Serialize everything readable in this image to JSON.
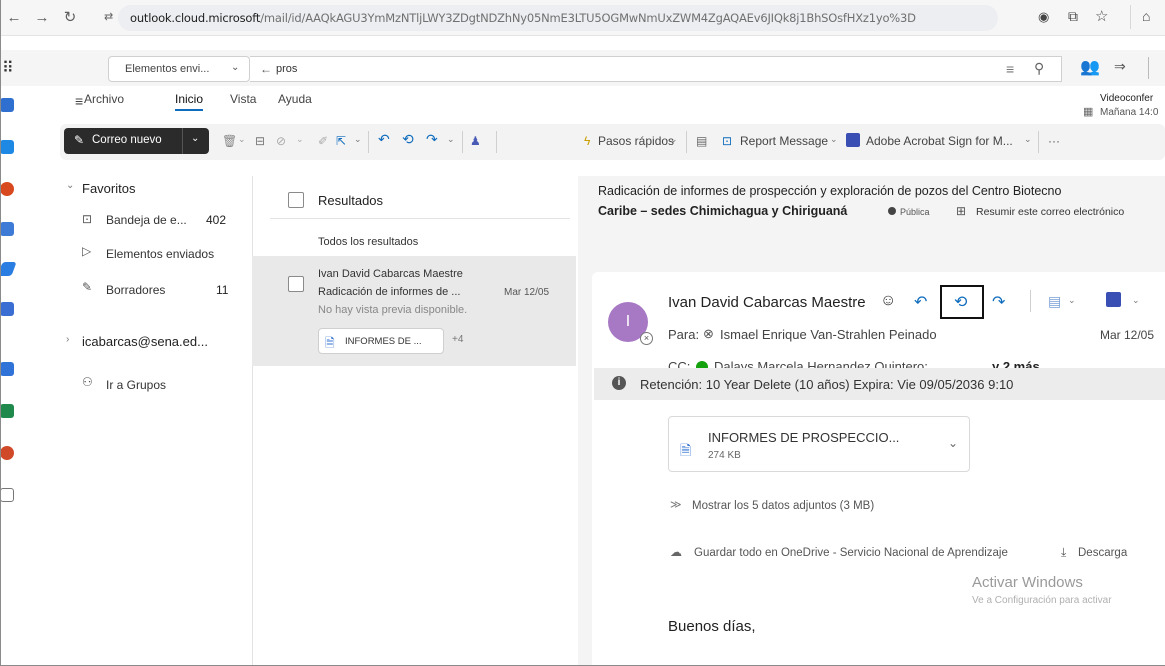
{
  "browser": {
    "url_host": "outlook.cloud.microsoft",
    "url_path": "/mail/id/AAQkAGU3YmMzNTljLWY3ZDgtNDZhNy05NmE3LTU5OGMwNmUxZWM4ZgAQAEv6JIQk8j1BhSOsfHXz1yo%3D"
  },
  "outlook": {
    "folder_dropdown": "Elementos envi...",
    "search_query": "pros",
    "meeting_title": "Videoconfer",
    "meeting_time": "Mañana 14:0"
  },
  "menu": {
    "tabs": [
      "Archivo",
      "Inicio",
      "Vista",
      "Ayuda"
    ]
  },
  "ribbon": {
    "new_mail": "Correo nuevo",
    "quick_steps": "Pasos rápidos",
    "report_message": "Report Message",
    "adobe": "Adobe Acrobat Sign for M...",
    "more": "···"
  },
  "folders": {
    "favorites_label": "Favoritos",
    "inbox": "Bandeja de e...",
    "inbox_count": "402",
    "sent": "Elementos enviados",
    "drafts": "Borradores",
    "drafts_count": "11",
    "account": "icabarcas@sena.ed...",
    "groups": "Ir a Grupos"
  },
  "message_list": {
    "title": "Resultados",
    "filter": "Todos los resultados",
    "items": [
      {
        "sender": "Ivan David Cabarcas Maestre",
        "subject": "Radicación de informes de ...",
        "date": "Mar 12/05",
        "preview": "No hay vista previa disponible.",
        "attachment": "INFORMES DE ...",
        "more_attachments": "+4"
      }
    ]
  },
  "reading": {
    "subject_line1": "Radicación de informes de prospección y exploración de pozos del Centro Biotecno",
    "subject_line2": "Caribe – sedes Chimichagua y Chiriguaná",
    "public_label": "Pública",
    "summarize": "Resumir este correo electrónico",
    "sender": "Ivan David Cabarcas Maestre",
    "avatar_initial": "I",
    "to_label": "Para:",
    "to_name": "Ismael Enrique Van-Strahlen Peinado",
    "date": "Mar 12/05",
    "cc_label": "CC:",
    "cc_name": "Dalays Marcela Hernandez Quintero;",
    "cc_more": "y 2 más",
    "retention": "Retención: 10 Year Delete (10 años) Expira: Vie 09/05/2036 9:10",
    "attachment_name": "INFORMES DE PROSPECCIO...",
    "attachment_size": "274 KB",
    "show_all": "Mostrar los 5 datos adjuntos (3 MB)",
    "save_all": "Guardar todo en OneDrive - Servicio Nacional de Aprendizaje",
    "download": "Descarga",
    "greeting": "Buenos días,"
  },
  "watermark": {
    "line1": "Activar Windows",
    "line2": "Ve a Configuración para activar"
  },
  "colors": {
    "accent": "#0f6cbd",
    "avatar": "#a779c4",
    "presence": "#13a10e"
  }
}
